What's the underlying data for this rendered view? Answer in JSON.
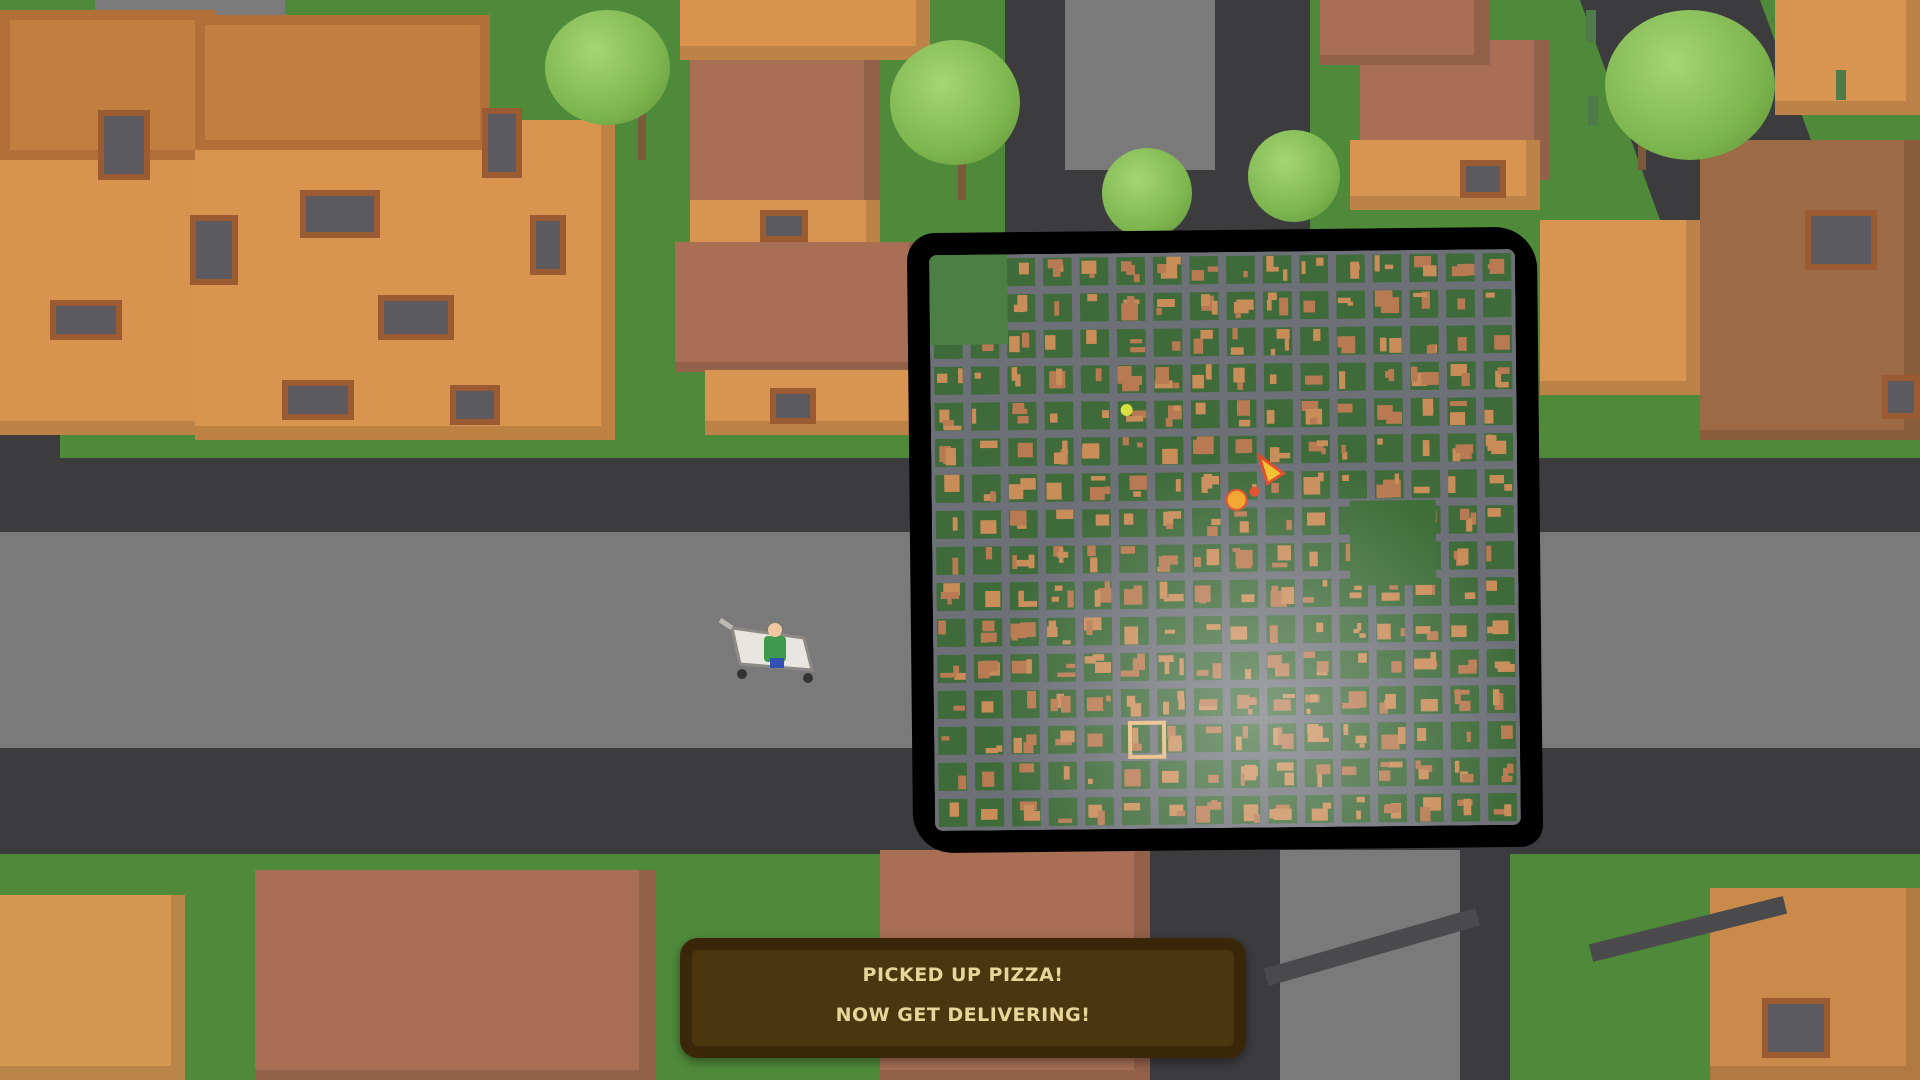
{
  "hud": {
    "message_line1": "PICKED UP PIZZA!",
    "message_line2": "NOW GET DELIVERING!"
  },
  "minimap": {
    "markers": [
      {
        "name": "pizza-slice-delivery-marker",
        "color": "#f2c12e"
      },
      {
        "name": "player-position-marker",
        "color": "#e04a2a"
      },
      {
        "name": "yellow-waypoint-marker",
        "color": "#d8e040"
      },
      {
        "name": "pizzeria-square-marker",
        "color": "#e7b87a"
      }
    ]
  },
  "colors": {
    "grass": "#4f8a3a",
    "road": "#7b7a7b",
    "building": "#d89552",
    "roof_brown": "#a86f55",
    "banner": "#4b360f",
    "banner_text": "#e9d49a"
  }
}
